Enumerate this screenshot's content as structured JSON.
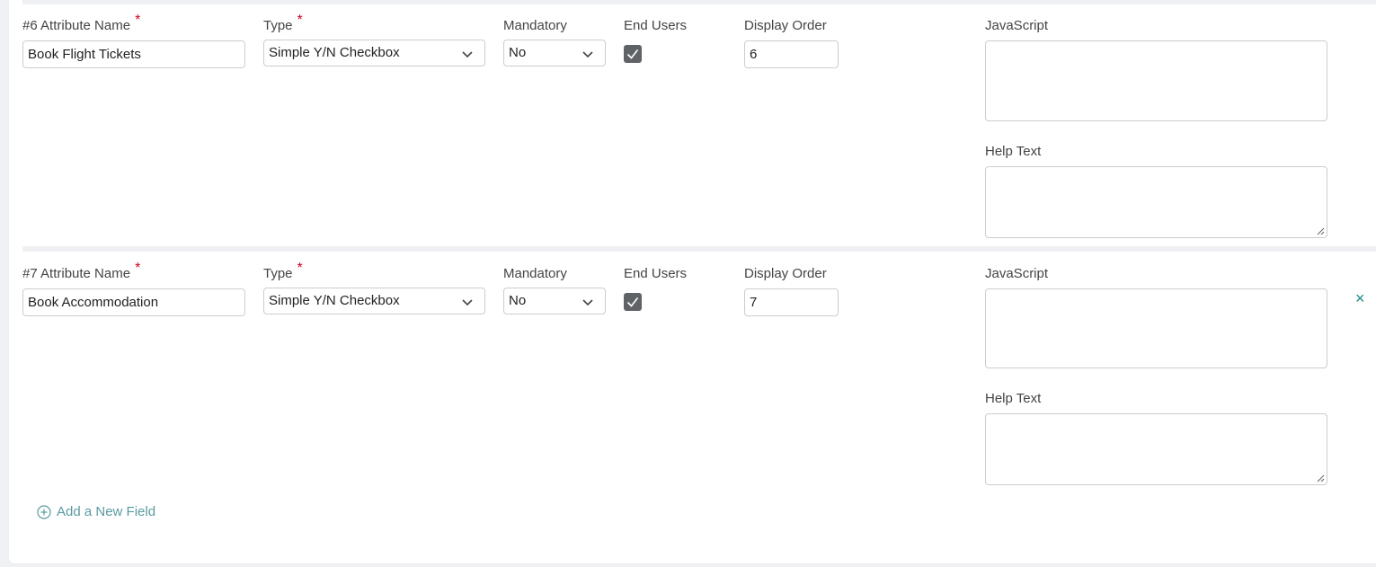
{
  "fields": [
    {
      "number_label": "#6 Attribute Name",
      "attribute_name": "Book Flight Tickets",
      "type_label": "Type",
      "type_value": "Simple Y/N Checkbox",
      "mandatory_label": "Mandatory",
      "mandatory_value": "No",
      "end_users_label": "End Users",
      "end_users_checked": true,
      "display_order_label": "Display Order",
      "display_order_value": "6",
      "javascript_label": "JavaScript",
      "help_text_label": "Help Text",
      "removable": false
    },
    {
      "number_label": "#7 Attribute Name",
      "attribute_name": "Book Accommodation",
      "type_label": "Type",
      "type_value": "Simple Y/N Checkbox",
      "mandatory_label": "Mandatory",
      "mandatory_value": "No",
      "end_users_label": "End Users",
      "end_users_checked": true,
      "display_order_label": "Display Order",
      "display_order_value": "7",
      "javascript_label": "JavaScript",
      "help_text_label": "Help Text",
      "removable": true,
      "remove_glyph": "×"
    }
  ],
  "required_marker": "*",
  "add_field": {
    "label": "Add a New Field",
    "icon": "plus-circle-icon"
  },
  "colors": {
    "required": "#d0021b",
    "accent": "#5b9aa0",
    "remove": "#1a8a8a",
    "checkbox": "#5f6368"
  }
}
